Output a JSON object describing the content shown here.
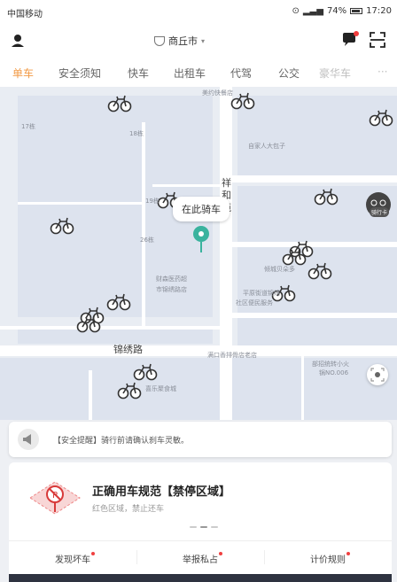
{
  "status_bar": {
    "carrier": "中国移动",
    "battery": "74%",
    "time": "17:20"
  },
  "header": {
    "city": "商丘市"
  },
  "tabs": [
    {
      "label": "单车"
    },
    {
      "label": "安全须知"
    },
    {
      "label": "快车"
    },
    {
      "label": "出租车"
    },
    {
      "label": "代驾"
    },
    {
      "label": "公交"
    },
    {
      "label": "豪华车"
    },
    {
      "label": "···"
    }
  ],
  "map": {
    "ride_here": "在此骑车",
    "ride_card": "骑行卡",
    "labels": {
      "l1": "美约快餐店",
      "l2": "17栋",
      "l3": "18栋",
      "l4": "自家人大包子",
      "l5": "19栋",
      "l6": "26栋",
      "l7": "祥",
      "l8": "和",
      "l9": "苑",
      "l10": "倾城贝朵多",
      "l11": "财森医药超",
      "l12": "市锦绣路店",
      "l13": "平原街道锦绣",
      "l14": "社区便民服务",
      "l15": "满口香排骨店老店",
      "l16": "部招统转小火",
      "l17": "锅NO.006",
      "l18": "喜乐聚食城"
    },
    "roads": {
      "r1": "锦绣路"
    }
  },
  "safety": {
    "text": "【安全提醒】骑行前请确认刹车灵敏。"
  },
  "rule_card": {
    "title": "正确用车规范【禁停区域】",
    "subtitle": "红色区域，禁止还车"
  },
  "actions": [
    {
      "label": "发现坏车"
    },
    {
      "label": "举报私占"
    },
    {
      "label": "计价规则"
    }
  ]
}
